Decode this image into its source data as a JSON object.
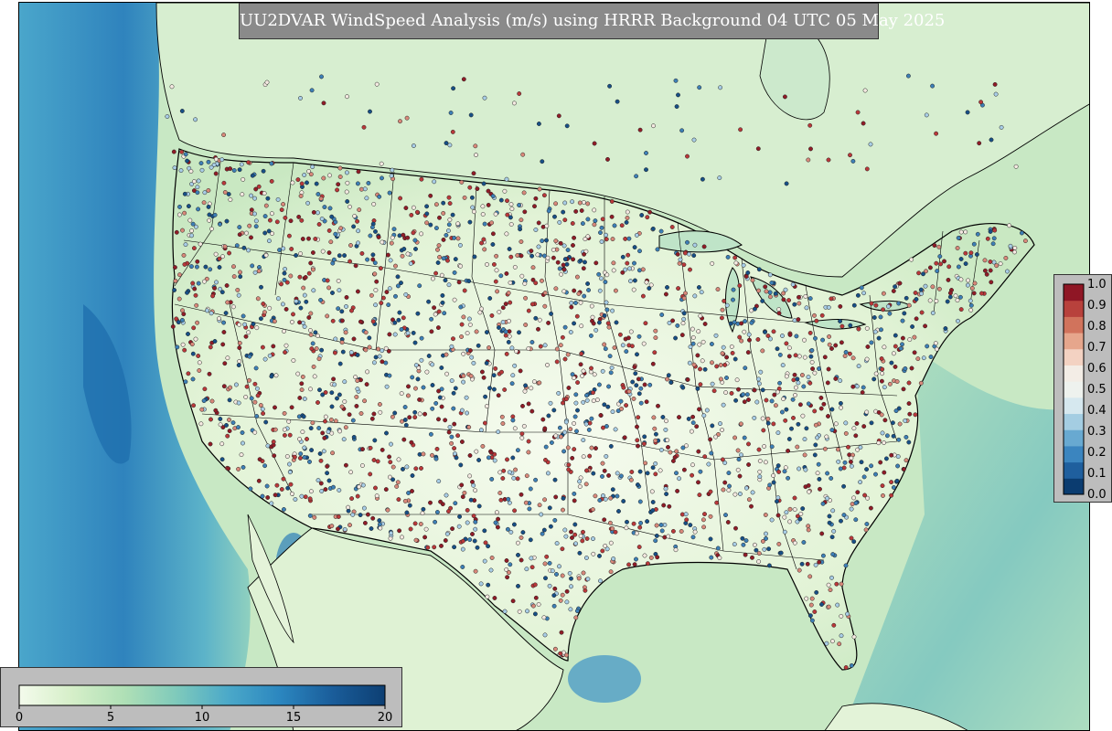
{
  "title": "UU2DVAR WindSpeed Analysis (m/s) using HRRR Background 04 UTC 05 May 2025",
  "colorbar_speed": {
    "ticks": [
      "0",
      "5",
      "10",
      "15",
      "20"
    ],
    "stops": [
      "#f4fbec",
      "#d6efc9",
      "#b0e0b6",
      "#7fcabb",
      "#4ba9c9",
      "#2b86bf",
      "#1a5d9a",
      "#0d3f73"
    ]
  },
  "colorbar_ratio": {
    "ticks": [
      "0.0",
      "0.1",
      "0.2",
      "0.3",
      "0.4",
      "0.5",
      "0.6",
      "0.7",
      "0.8",
      "0.9",
      "1.0"
    ],
    "colors": [
      "#0b3c70",
      "#1f5f9e",
      "#3b85bf",
      "#68a9d1",
      "#a4cde2",
      "#d6e8ef",
      "#eef2ee",
      "#f3ede6",
      "#f3d2c2",
      "#e6a68c",
      "#d1735c",
      "#b8413c",
      "#8f1625"
    ]
  },
  "stations": {
    "colors": [
      "#8f1c27",
      "#b9383a",
      "#d8887a",
      "#f4e9e1",
      "#a8cde6",
      "#3d7fb6",
      "#174f86"
    ]
  }
}
